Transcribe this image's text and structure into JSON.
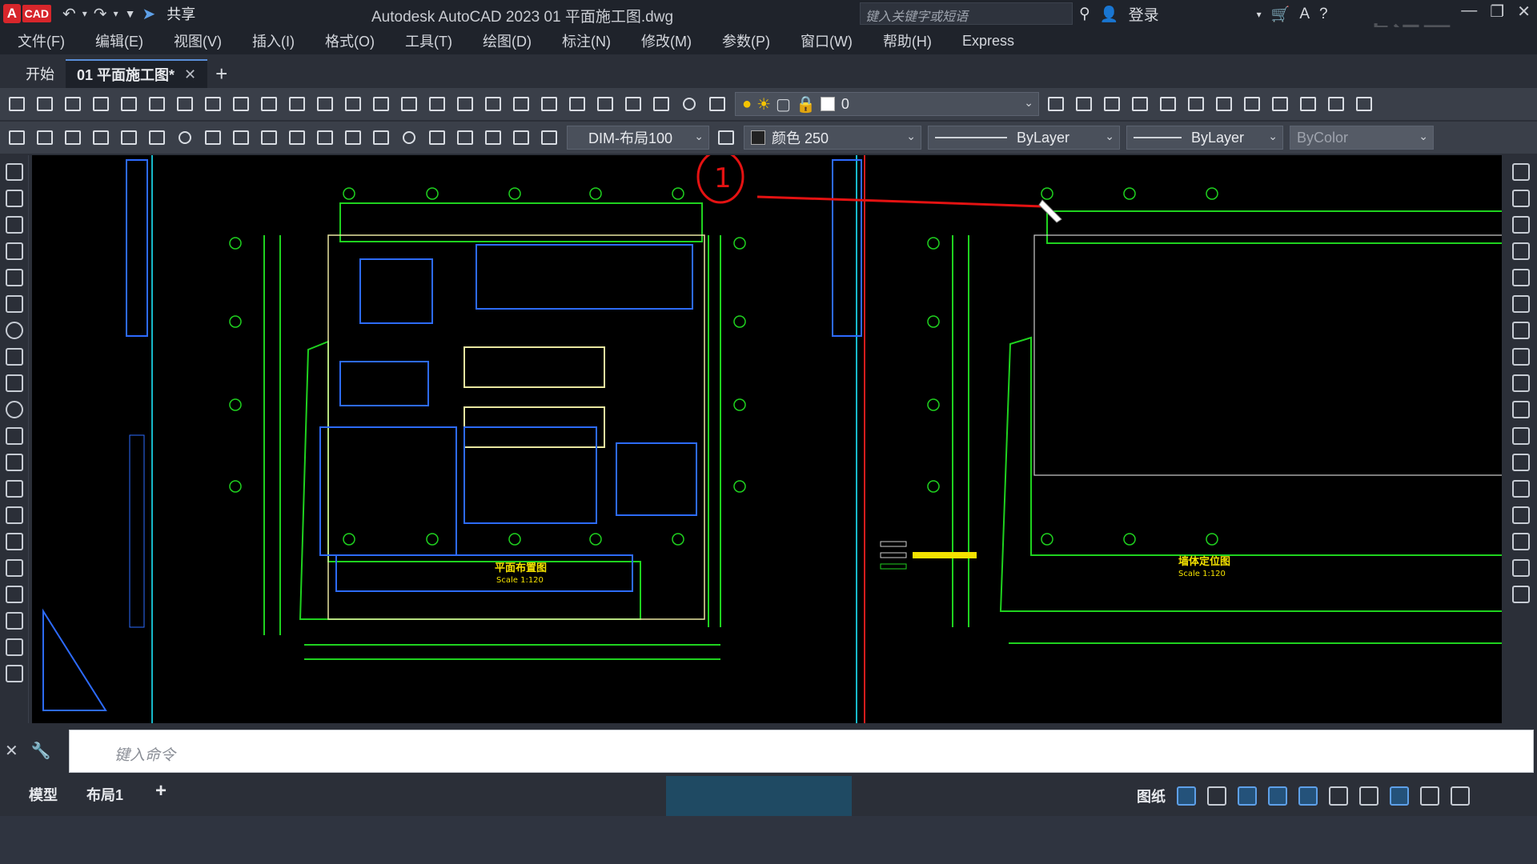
{
  "app": {
    "logo_letter": "A",
    "logo_text": "CAD",
    "share_label": "共享",
    "title": "Autodesk AutoCAD 2023    01 平面施工图.dwg",
    "search_placeholder": "键入关键字或短语",
    "login_label": "登录",
    "watermark": "虎课网"
  },
  "menu": {
    "items": [
      "文件(F)",
      "编辑(E)",
      "视图(V)",
      "插入(I)",
      "格式(O)",
      "工具(T)",
      "绘图(D)",
      "标注(N)",
      "修改(M)",
      "参数(P)",
      "窗口(W)",
      "帮助(H)",
      "Express"
    ]
  },
  "tabs": {
    "start": "开始",
    "document": "01 平面施工图*",
    "close": "✕",
    "add": "+"
  },
  "toolbar": {
    "layer_value": "0",
    "dimstyle_value": "DIM-布局100",
    "color_value": "颜色 250",
    "linetype_value": "ByLayer",
    "lineweight_value": "ByLayer",
    "plotstyle_value": "ByColor"
  },
  "drawing": {
    "annotation_number": "1",
    "left_plan_title": "平面布置图",
    "left_plan_scale": "Scale  1:120",
    "right_plan_title": "墙体定位图",
    "right_plan_scale": "Scale  1:120"
  },
  "command": {
    "placeholder": "键入命令"
  },
  "status": {
    "tab_model": "模型",
    "tab_layout": "布局1",
    "add_layout": "+",
    "paper_label": "图纸"
  },
  "colors": {
    "accent": "#5a8ed8",
    "cad_green": "#1fd21f",
    "cad_blue": "#2d6bff",
    "cad_cyan": "#17b8c9",
    "annotation_red": "#e41212",
    "viewport_red": "#d41c1c"
  }
}
